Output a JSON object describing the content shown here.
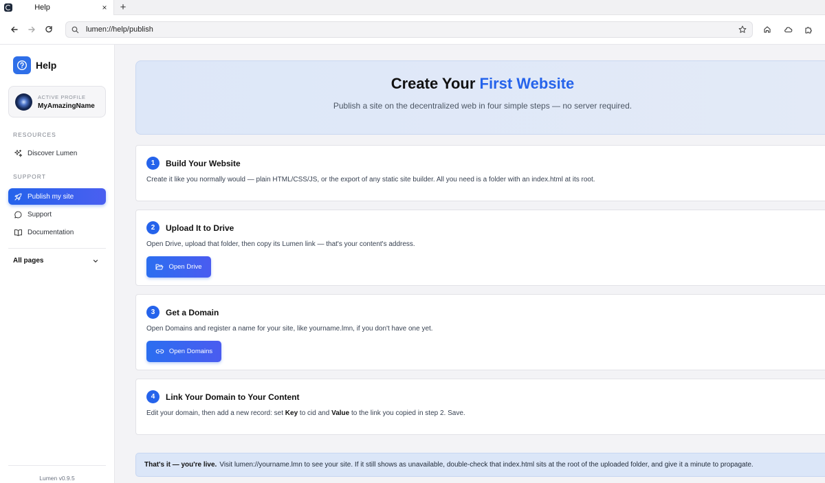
{
  "browser": {
    "tab_title": "Help",
    "tab_close": "×",
    "new_tab": "+",
    "url": "lumen://help/publish"
  },
  "sidebar": {
    "brand_title": "Help",
    "profile_label": "ACTIVE PROFILE",
    "profile_name": "MyAmazingName",
    "resources_title": "RESOURCES",
    "resources_items": [
      {
        "label": "Discover Lumen",
        "icon": "sparkles-icon"
      }
    ],
    "support_title": "SUPPORT",
    "support_items": [
      {
        "label": "Publish my site",
        "icon": "rocket-icon",
        "active": true
      },
      {
        "label": "Support",
        "icon": "chat-bubble-icon",
        "active": false
      },
      {
        "label": "Documentation",
        "icon": "book-icon",
        "active": false
      }
    ],
    "all_pages": "All pages",
    "version": "Lumen v0.9.5"
  },
  "hero": {
    "title_prefix": "Create Your ",
    "title_accent": "First Website",
    "subtitle": "Publish a site on the decentralized web in four simple steps — no server required."
  },
  "steps": [
    {
      "number": "1",
      "title": "Build Your Website",
      "description": "Create it like you normally would — plain HTML/CSS/JS, or the export of any static site builder. All you need is a folder with an index.html at its root."
    },
    {
      "number": "2",
      "title": "Upload It to Drive",
      "description": "Open Drive, upload that folder, then copy its Lumen link — that's your content's address.",
      "button_label": "Open Drive",
      "button_icon": "folder-open-icon"
    },
    {
      "number": "3",
      "title": "Get a Domain",
      "description": "Open Domains and register a name for your site, like yourname.lmn, if you don't have one yet.",
      "button_label": "Open Domains",
      "button_icon": "link-icon"
    },
    {
      "number": "4",
      "title": "Link Your Domain to Your Content",
      "description_parts": {
        "a": "Edit your domain, then add a new record: set ",
        "key": "Key",
        "b": " to cid and ",
        "value": "Value",
        "c": " to the link you copied in step 2. Save."
      }
    }
  ],
  "note": {
    "bold": "That's it — you're live.",
    "text": "Visit lumen://yourname.lmn to see your site. If it still shows as unavailable, double-check that index.html sits at the root of the uploaded folder, and give it a minute to propagate."
  },
  "colors": {
    "accent": "#2563eb",
    "hero_bg": "#dde7f8",
    "page_bg": "#f3f3f6"
  }
}
